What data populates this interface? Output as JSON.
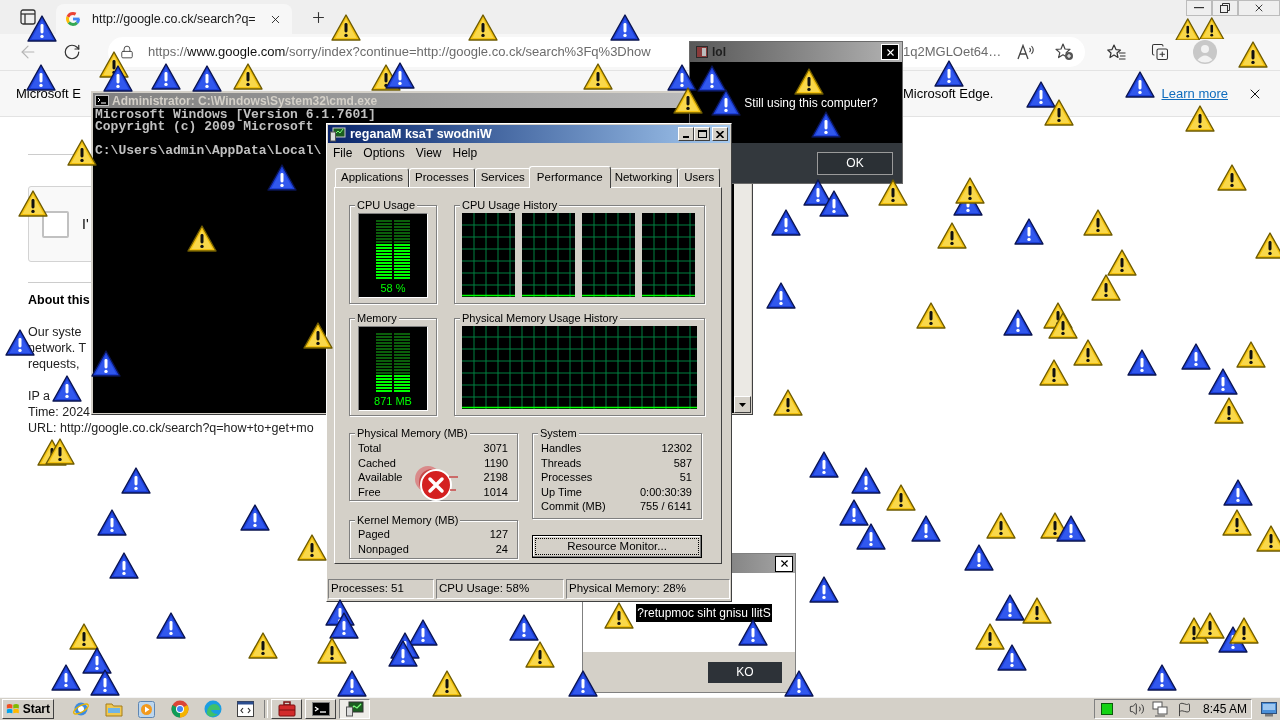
{
  "browser": {
    "tab": {
      "title": "http://google.co.ck/search?q="
    },
    "address_bar": {
      "scheme": "https://",
      "host": "www.google.com",
      "path_visible": "/sorry/index?continue=http://google.co.ck/search%3Fq%3Dhow",
      "tail_visible": "1q2MGLOet64…"
    },
    "info_bar": {
      "message_start_visible": "Microsoft E",
      "message_end_visible": "Microsoft Edge.",
      "link": "Learn more"
    },
    "page": {
      "captcha": {
        "checked": false,
        "label_visible": "I'"
      },
      "heading_visible": "About this",
      "paragraph_visible": [
        "Our syste",
        "network. T",
        "requests,"
      ],
      "details_visible": [
        "IP a",
        "Time: 2024",
        "URL: http://google.co.ck/search?q=how+to+get+mo"
      ]
    }
  },
  "cmd_window": {
    "title": "Administrator: C:\\Windows\\System32\\cmd.exe",
    "banner_visible": [
      "Microsoft Windows [Version 6.1.7601]",
      "Copyright (c) 2009 Microsoft"
    ],
    "prompt_visible": "C:\\Users\\admin\\AppData\\Local\\"
  },
  "lol_dialog": {
    "title": "lol",
    "message": "Still using this computer?",
    "button": "OK"
  },
  "mirrored_dialog": {
    "message": "?retupmoc siht gnisu llitS",
    "button": "KO"
  },
  "task_manager": {
    "title": "reganaM ksaT swodniW",
    "menu": [
      "File",
      "Options",
      "View",
      "Help"
    ],
    "tabs": [
      {
        "label": "Applications",
        "selected": false
      },
      {
        "label": "Processes",
        "selected": false
      },
      {
        "label": "Services",
        "selected": false
      },
      {
        "label": "Performance",
        "selected": true
      },
      {
        "label": "Networking",
        "selected": false
      },
      {
        "label": "Users",
        "selected": false
      }
    ],
    "cpu_usage": {
      "title": "CPU Usage",
      "reading": "58 %",
      "level": 0.58
    },
    "cpu_history": {
      "title": "CPU Usage History"
    },
    "memory": {
      "title": "Memory",
      "reading": "871 MB",
      "level": 0.28
    },
    "memory_history": {
      "title": "Physical Memory Usage History"
    },
    "physical_memory": {
      "title": "Physical Memory (MB)",
      "rows": [
        {
          "label": "Total",
          "value": "3071"
        },
        {
          "label": "Cached",
          "value": "1190"
        },
        {
          "label": "Available",
          "value": "2198"
        },
        {
          "label": "Free",
          "value": "1014"
        }
      ]
    },
    "kernel_memory": {
      "title": "Kernel Memory (MB)",
      "rows": [
        {
          "label": "Paged",
          "value": "127"
        },
        {
          "label": "Nonpaged",
          "value": "24"
        }
      ]
    },
    "system": {
      "title": "System",
      "rows": [
        {
          "label": "Handles",
          "value": "12302"
        },
        {
          "label": "Threads",
          "value": "587"
        },
        {
          "label": "Processes",
          "value": "51"
        },
        {
          "label": "Up Time",
          "value": "0:00:30:39"
        },
        {
          "label": "Commit (MB)",
          "value": "755 / 6141"
        }
      ]
    },
    "resource_monitor_button": {
      "label": "Resource Monitor...",
      "focused": true
    },
    "status_bar": [
      "Processes: 51",
      "CPU Usage: 58%",
      "Physical Memory: 28%"
    ]
  },
  "taskbar": {
    "start": "Start",
    "tasks": [
      {
        "kind": "toolbox",
        "selected": false
      },
      {
        "kind": "console",
        "selected": false
      },
      {
        "kind": "monitor",
        "selected": true
      }
    ],
    "clock": "8:45 AM"
  }
}
